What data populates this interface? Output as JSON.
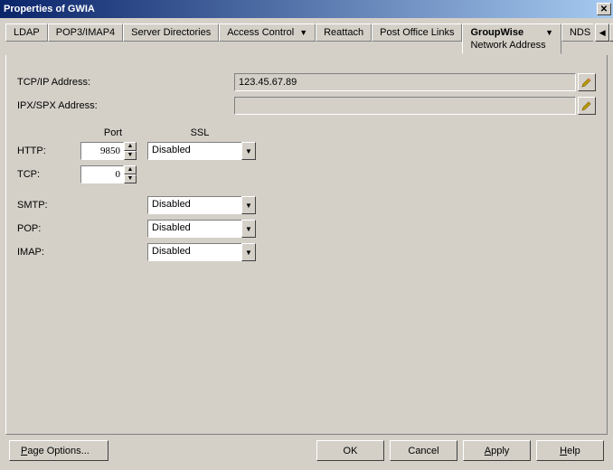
{
  "window": {
    "title": "Properties of GWIA",
    "close_glyph": "✕"
  },
  "tabs": {
    "items": [
      {
        "label": "LDAP"
      },
      {
        "label": "POP3/IMAP4"
      },
      {
        "label": "Server Directories"
      },
      {
        "label": "Access Control",
        "dropdown": true
      },
      {
        "label": "Reattach"
      },
      {
        "label": "Post Office Links"
      }
    ],
    "active": {
      "label": "GroupWise",
      "subline": "Network Address",
      "dropdown": true
    },
    "overflow": {
      "label": "NDS"
    },
    "scroll_left": "◀",
    "scroll_right": "▶"
  },
  "network": {
    "tcpip_label": "TCP/IP Address:",
    "tcpip_value": "123.45.67.89",
    "ipxspx_label": "IPX/SPX Address:",
    "ipxspx_value": ""
  },
  "port_grid": {
    "port_header": "Port",
    "ssl_header": "SSL",
    "rows": {
      "http": {
        "label": "HTTP:",
        "port": "9850",
        "ssl": "Disabled"
      },
      "tcp": {
        "label": "TCP:",
        "port": "0"
      },
      "smtp": {
        "label": "SMTP:",
        "ssl": "Disabled"
      },
      "pop": {
        "label": "POP:",
        "ssl": "Disabled"
      },
      "imap": {
        "label": "IMAP:",
        "ssl": "Disabled"
      }
    }
  },
  "buttons": {
    "page_options": "Page Options...",
    "ok": "OK",
    "cancel": "Cancel",
    "apply": "Apply",
    "help": "Help"
  }
}
